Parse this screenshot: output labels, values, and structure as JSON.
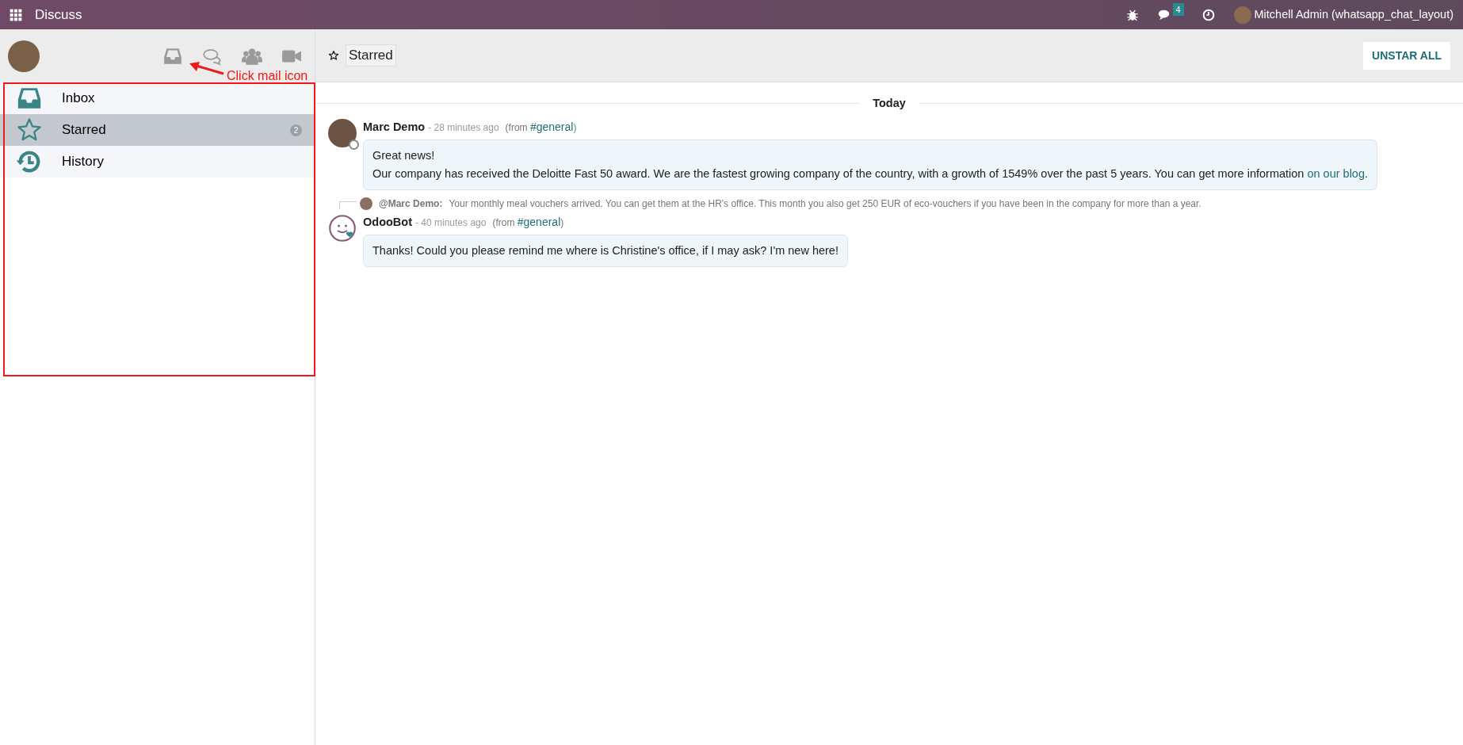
{
  "navbar": {
    "app_name": "Discuss",
    "chat_badge": "4",
    "user_name": "Mitchell Admin (whatsapp_chat_layout)"
  },
  "sidebar": {
    "annotation": "Click mail icon",
    "items": [
      {
        "kind": "inbox",
        "label": "Inbox",
        "selected": false
      },
      {
        "kind": "starred",
        "label": "Starred",
        "selected": true,
        "counter": "2"
      },
      {
        "kind": "history",
        "label": "History",
        "selected": false
      }
    ]
  },
  "thread": {
    "title": "Starred",
    "action": "UNSTAR ALL",
    "separator": "Today",
    "messages": [
      {
        "kind": "photo",
        "author": "Marc Demo",
        "time": "- 28 minutes ago",
        "origin_open": "(from",
        "channel": "#general",
        "origin_close": ")",
        "paragraphs": [
          {
            "text": "Great news!"
          },
          {
            "text": "Our company has received the Deloitte Fast 50 award. We are the fastest growing company of the country, with a growth of 1549% over the past 5 years. You can get more information",
            "link": "on our blog",
            "tail": "."
          }
        ]
      },
      {
        "kind": "bot",
        "reply_to": {
          "author": "@Marc Demo:",
          "text": "Your monthly meal vouchers arrived. You can get them at the HR's office. This month you also get 250 EUR of eco-vouchers if you have been in the company for more than a year."
        },
        "author": "OdooBot",
        "time": "- 40 minutes ago",
        "origin_open": "(from",
        "channel": "#general",
        "origin_close": ")",
        "paragraphs": [
          {
            "text": "Thanks! Could you please remind me where is Christine's office, if I may ask? I'm new here!"
          }
        ]
      }
    ]
  }
}
